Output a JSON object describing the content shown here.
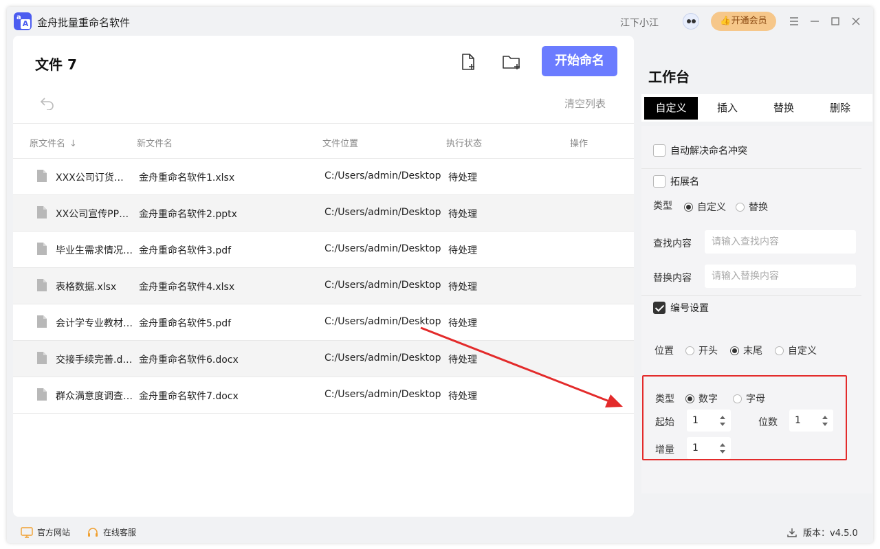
{
  "app": {
    "title": "金舟批量重命名软件",
    "logo_letters": [
      "a",
      "A"
    ]
  },
  "header": {
    "username": "江下小江",
    "vip_label": "开通会员"
  },
  "toolbar": {
    "file_count": "文件 7",
    "start_label": "开始命名",
    "clear_label": "清空列表"
  },
  "table": {
    "columns": [
      "原文件名",
      "新文件名",
      "文件位置",
      "执行状态",
      "操作"
    ],
    "sort_arrow": "↓",
    "rows": [
      {
        "orig": "XXX公司订货单.xlsx",
        "new": "金舟重命名软件1.xlsx",
        "loc": "C:/Users/admin/Desktop",
        "status": "待处理"
      },
      {
        "orig": "XX公司宣传PPT.pptx",
        "new": "金舟重命名软件2.pptx",
        "loc": "C:/Users/admin/Desktop",
        "status": "待处理"
      },
      {
        "orig": "毕业生需求情况.pdf",
        "new": "金舟重命名软件3.pdf",
        "loc": "C:/Users/admin/Desktop",
        "status": "待处理"
      },
      {
        "orig": "表格数据.xlsx",
        "new": "金舟重命名软件4.xlsx",
        "loc": "C:/Users/admin/Desktop",
        "status": "待处理"
      },
      {
        "orig": "会计学专业教材.pdf",
        "new": "金舟重命名软件5.pdf",
        "loc": "C:/Users/admin/Desktop",
        "status": "待处理"
      },
      {
        "orig": "交接手续完善.docx",
        "new": "金舟重命名软件6.docx",
        "loc": "C:/Users/admin/Desktop",
        "status": "待处理"
      },
      {
        "orig": "群众满意度调查.docx",
        "new": "金舟重命名软件7.docx",
        "loc": "C:/Users/admin/Desktop",
        "status": "待处理"
      }
    ]
  },
  "workspace": {
    "title": "工作台",
    "tabs": [
      "自定义",
      "插入",
      "替换",
      "删除"
    ],
    "auto_resolve": "自动解决命名冲突",
    "extension": {
      "label": "拓展名",
      "type_label": "类型",
      "type_options": [
        "自定义",
        "替换"
      ],
      "find_label": "查找内容",
      "find_placeholder": "请输入查找内容",
      "replace_label": "替换内容",
      "replace_placeholder": "请输入替换内容"
    },
    "numbering": {
      "label": "编号设置",
      "position_label": "位置",
      "position_options": [
        "开头",
        "末尾",
        "自定义"
      ],
      "type_label": "类型",
      "type_options": [
        "数字",
        "字母"
      ],
      "start_label": "起始",
      "start_value": "1",
      "digits_label": "位数",
      "digits_value": "1",
      "increment_label": "增量",
      "increment_value": "1"
    }
  },
  "footer": {
    "website": "官方网站",
    "support": "在线客服",
    "version": "版本：v4.5.0"
  },
  "colors": {
    "accent": "#6b7cff",
    "logo": "#4b5cf0",
    "vip": "#f6c78a",
    "annotation": "#e32b2b"
  }
}
